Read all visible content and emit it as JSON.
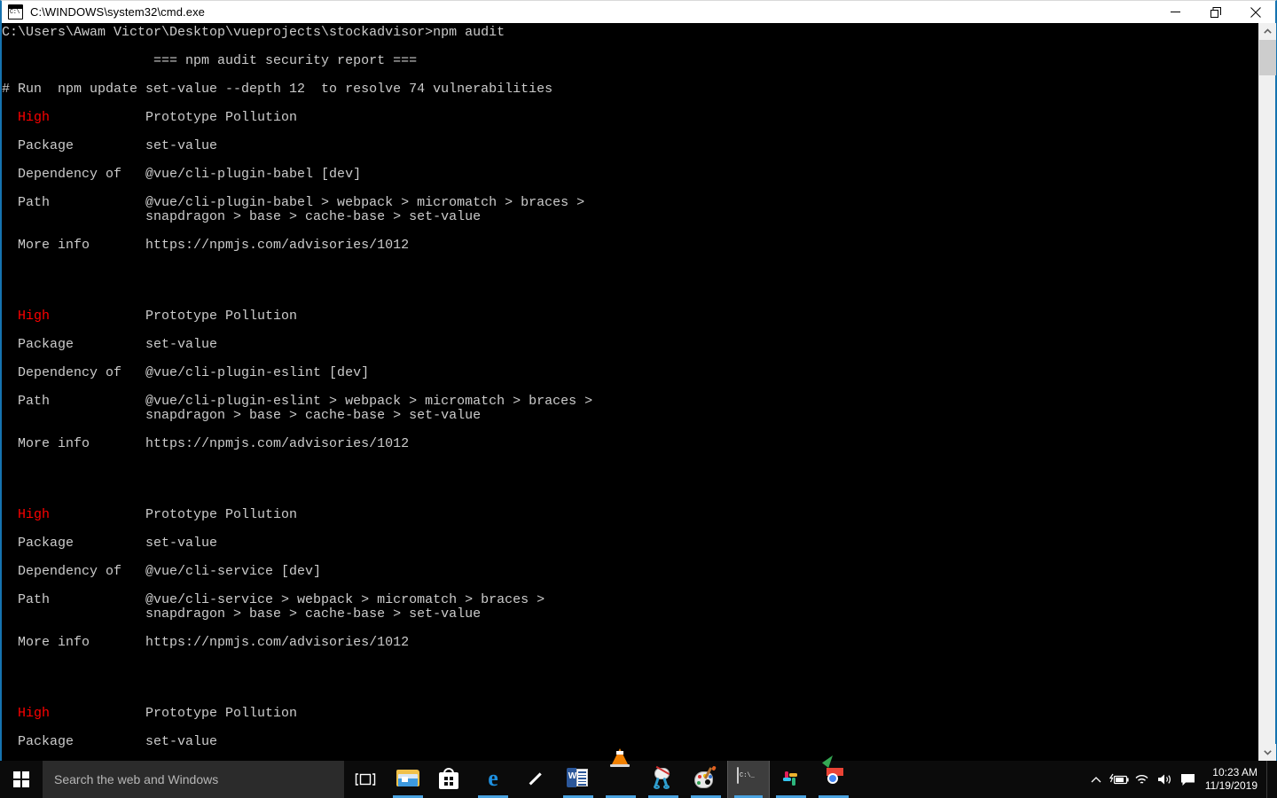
{
  "window": {
    "title": "C:\\WINDOWS\\system32\\cmd.exe",
    "icon": "cmd-icon",
    "controls": {
      "minimize_label": "Minimize",
      "maximize_label": "Restore",
      "close_label": "Close"
    }
  },
  "console": {
    "prompt_line": "C:\\Users\\Awam Victor\\Desktop\\vueprojects\\stockadvisor>npm audit",
    "report_header": "                   === npm audit security report ===",
    "remediation": "# Run  npm update set-value --depth 12  to resolve 74 vulnerabilities",
    "vuln_count": 74,
    "fix_package": "set-value",
    "fix_depth": 12,
    "severity_label": "High",
    "title_label": "Prototype Pollution",
    "field_labels": {
      "package": "Package",
      "dependency_of": "Dependency of",
      "path": "Path",
      "more_info": "More info"
    },
    "advisories": [
      {
        "severity": "High",
        "title": "Prototype Pollution",
        "package": "set-value",
        "dependency_of": "@vue/cli-plugin-babel [dev]",
        "path_line1": "@vue/cli-plugin-babel > webpack > micromatch > braces >",
        "path_line2": "snapdragon > base > cache-base > set-value",
        "more_info": "https://npmjs.com/advisories/1012"
      },
      {
        "severity": "High",
        "title": "Prototype Pollution",
        "package": "set-value",
        "dependency_of": "@vue/cli-plugin-eslint [dev]",
        "path_line1": "@vue/cli-plugin-eslint > webpack > micromatch > braces >",
        "path_line2": "snapdragon > base > cache-base > set-value",
        "more_info": "https://npmjs.com/advisories/1012"
      },
      {
        "severity": "High",
        "title": "Prototype Pollution",
        "package": "set-value",
        "dependency_of": "@vue/cli-service [dev]",
        "path_line1": "@vue/cli-service > webpack > micromatch > braces >",
        "path_line2": "snapdragon > base > cache-base > set-value",
        "more_info": "https://npmjs.com/advisories/1012"
      },
      {
        "severity": "High",
        "title": "Prototype Pollution",
        "package": "set-value",
        "dependency_of": "",
        "path_line1": "",
        "path_line2": "",
        "more_info": ""
      }
    ],
    "colors": {
      "background": "#000000",
      "foreground": "#cccccc",
      "severity_high": "#ff0000"
    }
  },
  "taskbar": {
    "start_label": "Start",
    "search_placeholder": "Search the web and Windows",
    "task_view_label": "Task View",
    "items": [
      {
        "name": "file-explorer",
        "label": "File Explorer",
        "active": false,
        "running": true
      },
      {
        "name": "microsoft-store",
        "label": "Microsoft Store",
        "active": false,
        "running": false
      },
      {
        "name": "microsoft-edge",
        "label": "Microsoft Edge",
        "active": false,
        "running": true
      },
      {
        "name": "pen-app",
        "label": "Pen App",
        "active": false,
        "running": false
      },
      {
        "name": "microsoft-word",
        "label": "Microsoft Word",
        "active": false,
        "running": true
      },
      {
        "name": "vlc-media-player",
        "label": "VLC media player",
        "active": false,
        "running": true
      },
      {
        "name": "snipping-tool",
        "label": "Snipping Tool",
        "active": false,
        "running": true
      },
      {
        "name": "paint",
        "label": "Paint",
        "active": false,
        "running": true
      },
      {
        "name": "command-prompt",
        "label": "Command Prompt",
        "active": true,
        "running": true
      },
      {
        "name": "slack",
        "label": "Slack",
        "active": false,
        "running": true
      },
      {
        "name": "google-chrome",
        "label": "Google Chrome",
        "active": false,
        "running": true
      }
    ],
    "tray": {
      "show_hidden_label": "Show hidden icons",
      "battery_label": "Battery charging",
      "network_label": "Network",
      "volume_label": "Volume",
      "action_center_label": "Action Center"
    },
    "clock": {
      "time": "10:23 AM",
      "date": "11/19/2019"
    }
  }
}
